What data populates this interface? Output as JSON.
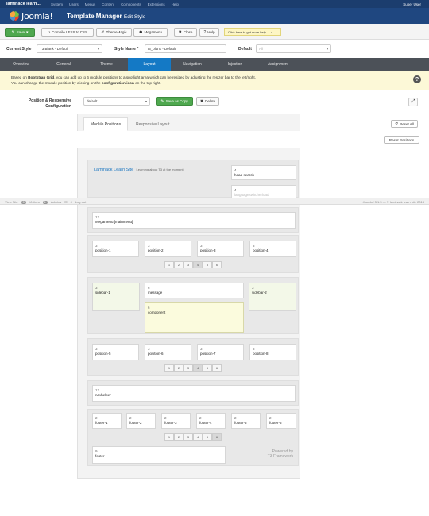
{
  "adminbar": {
    "site": "laminack learn...",
    "menu": [
      "System",
      "Users",
      "Menus",
      "Content",
      "Components",
      "Extensions",
      "Help"
    ],
    "user": "Super User"
  },
  "header": {
    "logo": "Joomla!",
    "title": "Template Manager",
    "subtitle": "Edit Style"
  },
  "toolbar": {
    "save": "Save",
    "compile": "Compile LESS to CSS",
    "thememagic": "ThemeMagic",
    "megamenu": "Megamenu",
    "close": "Close",
    "help": "Help",
    "note": "Click here to get more help",
    "note_close": "×"
  },
  "style_row": {
    "current_label": "Current Style",
    "current_value": "T3 Blank - Default",
    "name_label": "Style Name *",
    "name_value": "t3_blank - Default",
    "default_label": "Default",
    "default_value": "All"
  },
  "tabs": [
    "Overview",
    "General",
    "Theme",
    "Layout",
    "Navigation",
    "Injection",
    "Assignment"
  ],
  "active_tab": "Layout",
  "info": {
    "line1a": "Based on ",
    "line1b": "Bootstrap Grid",
    "line1c": ", you can add up to 6 module positions to a spotlight area which can be resized by adjusting the resizer bar to the left/right.",
    "line2a": "You can change the module position by clicking on the ",
    "line2b": "configuration icon",
    "line2c": " on the top right."
  },
  "position_config": {
    "label1": "Position & Responsive",
    "label2": "Configuration",
    "select": "default",
    "save_copy": "Save as Copy",
    "delete": "Delete"
  },
  "layout_tabs": {
    "positions": "Module Positions",
    "responsive": "Responsive Layout",
    "reset_all": "Reset All",
    "reset_positions": "Reset Positions"
  },
  "header_block": {
    "site_name": "Laminack Learn Site",
    "tagline": "Learning about T3 at the moment",
    "head_search_n": "4",
    "head_search": "head-search",
    "second_n": "4",
    "second": "languageswitcherload"
  },
  "statusbar": {
    "view_site": "View Site",
    "visitors_n": "0",
    "visitors": "Visitors",
    "admins_n": "1",
    "admins": "Admins",
    "messages_n": "0",
    "logout": "Log out",
    "right": "Joomla! 3.1.5 — © laminack learn site 2013"
  },
  "mainnav": {
    "n": "12",
    "label": "Megamenu [mainmenu]"
  },
  "spot1": {
    "items": [
      {
        "n": "3",
        "p": "position-1"
      },
      {
        "n": "3",
        "p": "position-2"
      },
      {
        "n": "3",
        "p": "position-3"
      },
      {
        "n": "3",
        "p": "position-4"
      }
    ],
    "pager": [
      "1",
      "2",
      "3",
      "4",
      "5",
      "6"
    ],
    "active": "4"
  },
  "main": {
    "sidebar1_n": "3",
    "sidebar1": "sidebar-1",
    "message_n": "6",
    "message": "message",
    "component_n": "6",
    "component": "component",
    "sidebar2_n": "3",
    "sidebar2": "sidebar-2"
  },
  "spot2": {
    "items": [
      {
        "n": "3",
        "p": "position-5"
      },
      {
        "n": "3",
        "p": "position-6"
      },
      {
        "n": "3",
        "p": "position-7"
      },
      {
        "n": "3",
        "p": "position-8"
      }
    ],
    "pager": [
      "1",
      "2",
      "3",
      "4",
      "5",
      "6"
    ],
    "active": "4"
  },
  "navhelper": {
    "n": "12",
    "label": "navhelper"
  },
  "footer_spot": {
    "items": [
      {
        "n": "2",
        "p": "footer-1"
      },
      {
        "n": "2",
        "p": "footer-2"
      },
      {
        "n": "2",
        "p": "footer-3"
      },
      {
        "n": "2",
        "p": "footer-4"
      },
      {
        "n": "2",
        "p": "footer-5"
      },
      {
        "n": "2",
        "p": "footer-6"
      }
    ],
    "pager": [
      "1",
      "2",
      "3",
      "4",
      "5",
      "6"
    ],
    "active": "6"
  },
  "footer": {
    "n": "9",
    "label": "footer",
    "powered1": "Powered by",
    "powered2": "T3 Framework"
  },
  "colors": {
    "accent": "#1479c5",
    "save_green": "#4fa84f",
    "header_blue": "#1f4780"
  }
}
